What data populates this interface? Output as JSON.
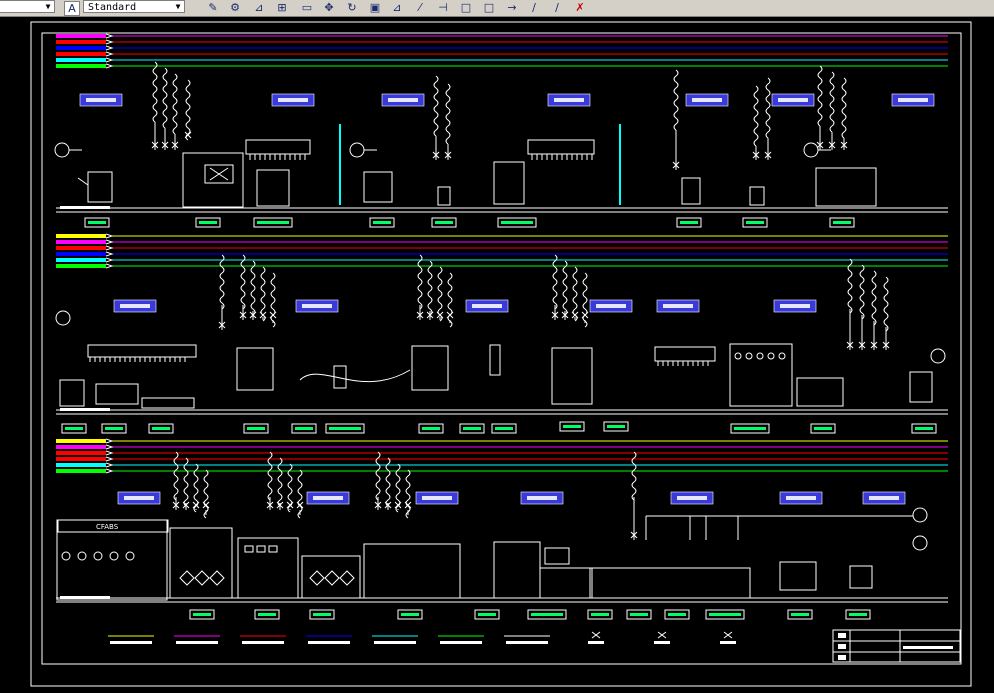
{
  "toolbar": {
    "style_combo_value": "Standard",
    "icons": [
      "draw-icon",
      "snap-icon",
      "mirror-icon",
      "grid-icon",
      "pan-icon",
      "rotate-icon",
      "box-icon",
      "polyline-icon",
      "trim-icon",
      "rect-icon",
      "square-icon",
      "move-icon",
      "pen-icon",
      "pointer-icon",
      "paint-icon"
    ]
  },
  "drawing": {
    "line_colors": [
      "#ff00ff",
      "#ff0000",
      "#0000ff",
      "#00ffff",
      "#00ff00",
      "#ffff00"
    ],
    "label_color": "#3a3ad8",
    "title_block_text": "CFABS"
  }
}
